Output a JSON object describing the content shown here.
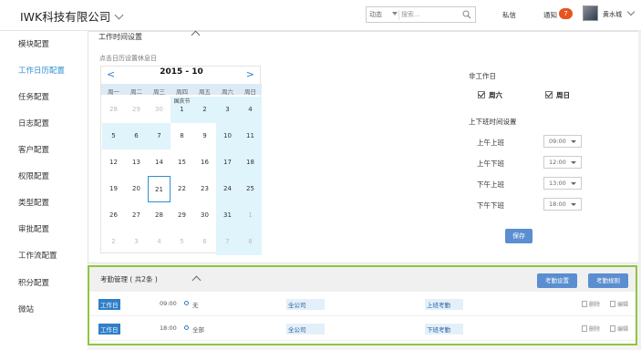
{
  "header": {
    "company": "IWK科技有限公司",
    "search_scope": "动态",
    "search_placeholder": "搜索...",
    "messages": "私信",
    "notifications": "通知",
    "notification_count": "7",
    "user_name": "黄水城"
  },
  "sidebar": {
    "items": [
      {
        "label": "模块配置",
        "active": false
      },
      {
        "label": "工作日历配置",
        "active": true
      },
      {
        "label": "任务配置",
        "active": false
      },
      {
        "label": "日志配置",
        "active": false
      },
      {
        "label": "客户配置",
        "active": false
      },
      {
        "label": "权限配置",
        "active": false
      },
      {
        "label": "类型配置",
        "active": false
      },
      {
        "label": "审批配置",
        "active": false
      },
      {
        "label": "工作流配置",
        "active": false
      },
      {
        "label": "积分配置",
        "active": false
      },
      {
        "label": "微站",
        "active": false
      }
    ]
  },
  "worktime": {
    "title": "工作时间设置",
    "hint": "点击日历设置休息日",
    "calendar": {
      "month_label": "2015 - 10",
      "prev": "<",
      "next": ">",
      "weekdays": [
        "周一",
        "周二",
        "周三",
        "周四",
        "周五",
        "周六",
        "周日"
      ],
      "holiday_note": "国庆节",
      "rows": [
        [
          "28",
          "29",
          "30",
          "1",
          "2",
          "3",
          "4"
        ],
        [
          "5",
          "6",
          "7",
          "8",
          "9",
          "10",
          "11"
        ],
        [
          "12",
          "13",
          "14",
          "15",
          "16",
          "17",
          "18"
        ],
        [
          "19",
          "20",
          "21",
          "22",
          "23",
          "24",
          "25"
        ],
        [
          "26",
          "27",
          "28",
          "29",
          "30",
          "31",
          "1"
        ],
        [
          "2",
          "3",
          "4",
          "5",
          "6",
          "7",
          "8"
        ]
      ]
    },
    "nonwork_title": "非工作日",
    "nonwork_days": [
      {
        "label": "周六",
        "checked": true
      },
      {
        "label": "周日",
        "checked": true
      }
    ],
    "schedule_title": "上下班时间设置",
    "schedule": [
      {
        "label": "上午上班",
        "value": "09:00"
      },
      {
        "label": "上午下班",
        "value": "12:00"
      },
      {
        "label": "下午上班",
        "value": "13:00"
      },
      {
        "label": "下午下班",
        "value": "18:00"
      }
    ],
    "save_label": "保存"
  },
  "attendance": {
    "title": "考勤管理 ( 共2条 )",
    "settings_btn": "考勤设置",
    "add_btn": "考勤规则",
    "rows": [
      {
        "type": "工作日",
        "time": "09:00",
        "who": "无",
        "scope": "全公司",
        "kind": "上班考勤",
        "delete": "删除",
        "edit": "编辑"
      },
      {
        "type": "工作日",
        "time": "18:00",
        "who": "全部",
        "scope": "全公司",
        "kind": "下班考勤",
        "delete": "删除",
        "edit": "编辑"
      }
    ]
  },
  "colors": {
    "accent": "#2f8fd0",
    "button": "#5a8ed0",
    "holiday_bg": "#e0f4fb",
    "highlight_border": "#8fc63d",
    "badge": "#e8541e"
  }
}
